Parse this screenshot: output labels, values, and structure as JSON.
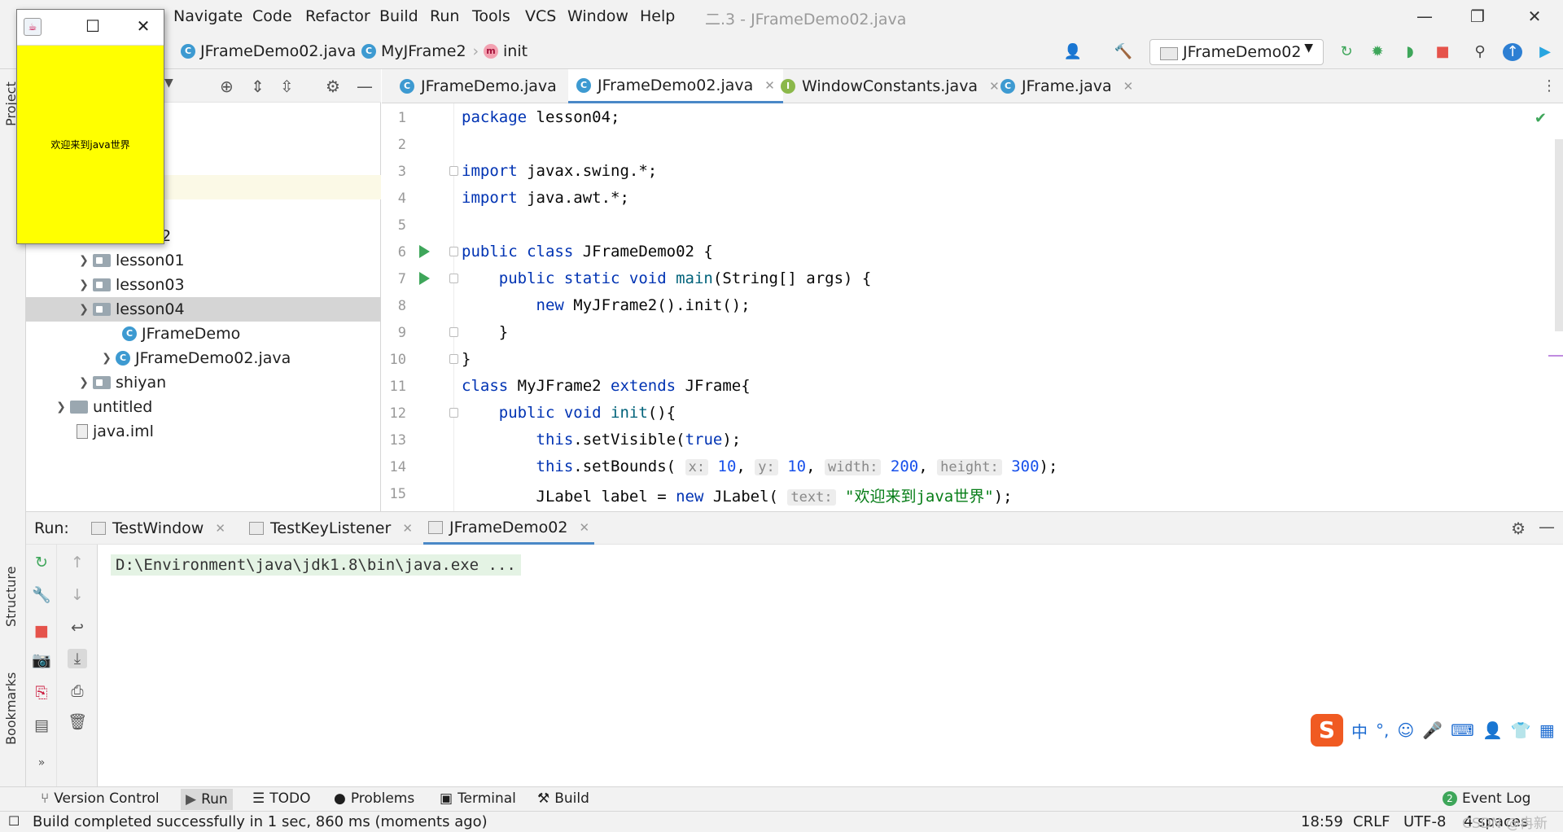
{
  "menubar": {
    "items": [
      "Navigate",
      "Code",
      "Refactor",
      "Build",
      "Run",
      "Tools",
      "VCS",
      "Window",
      "Help"
    ],
    "window_title": "二.3 - JFrameDemo02.java"
  },
  "navbar": {
    "breadcrumbs": [
      "JFrameDemo02.java",
      "MyJFrame2",
      "init"
    ],
    "run_config": "JFrameDemo02"
  },
  "sidebar": {
    "project_tab": "Project",
    "structure_tab": "Structure",
    "bookmarks_tab": "Bookmarks"
  },
  "project_tree": [
    {
      "label": "02",
      "indent": 3,
      "arrow": ""
    },
    {
      "label": "lesson01",
      "indent": 3,
      "arrow": ">"
    },
    {
      "label": "lesson03",
      "indent": 3,
      "arrow": ">"
    },
    {
      "label": "lesson04",
      "indent": 3,
      "arrow": "v"
    },
    {
      "label": "JFrameDemo",
      "indent": 4,
      "arrow": ""
    },
    {
      "label": "JFrameDemo02.java",
      "indent": 4,
      "arrow": ">"
    },
    {
      "label": "shiyan",
      "indent": 3,
      "arrow": ">"
    },
    {
      "label": "untitled",
      "indent": 2,
      "arrow": ">"
    },
    {
      "label": "java.iml",
      "indent": 2,
      "arrow": ""
    }
  ],
  "editor_tabs": [
    {
      "label": "JFrameDemo.java",
      "icon": "C"
    },
    {
      "label": "JFrameDemo02.java",
      "icon": "C"
    },
    {
      "label": "WindowConstants.java",
      "icon": "I"
    },
    {
      "label": "JFrame.java",
      "icon": "C"
    }
  ],
  "code": {
    "line_numbers": [
      "1",
      "2",
      "3",
      "4",
      "5",
      "6",
      "7",
      "8",
      "9",
      "10",
      "11",
      "12",
      "13",
      "14",
      "15"
    ],
    "l1a": "package",
    "l1b": " lesson04;",
    "l3a": "import",
    "l3b": " javax.swing.*;",
    "l4a": "import",
    "l4b": " java.awt.*;",
    "l6a": "public class",
    "l6b": " JFrameDemo02 {",
    "l7a": "    public static void",
    "l7b": " main",
    "l7c": "(String[] args) {",
    "l8a": "        new",
    "l8b": " MyJFrame2().init();",
    "l9": "    }",
    "l10": "}",
    "l11a": "class",
    "l11b": " MyJFrame2 ",
    "l11c": "extends",
    "l11d": " JFrame{",
    "l12a": "    public void",
    "l12b": " init",
    "l12c": "(){",
    "l13a": "        this",
    "l13b": ".setVisible(",
    "l13c": "true",
    "l13d": ");",
    "l14a": "        this",
    "l14b": ".setBounds(",
    "l14h1": "x:",
    "l14v1": "10",
    "l14h2": "y:",
    "l14v2": "10",
    "l14h3": "width:",
    "l14v3": "200",
    "l14h4": "height:",
    "l14v4": "300",
    "l14e": ");",
    "l15a": "        JLabel label = ",
    "l15b": "new",
    "l15c": " JLabel(",
    "l15h": "text:",
    "l15s": "\"欢迎来到java世界\"",
    "l15e": ");"
  },
  "run_panel": {
    "label": "Run:",
    "tabs": [
      "TestWindow",
      "TestKeyListener",
      "JFrameDemo02"
    ],
    "console_line": "D:\\Environment\\java\\jdk1.8\\bin\\java.exe ..."
  },
  "ime": {
    "logo": "S",
    "lang": "中"
  },
  "bottom_tools": [
    "Version Control",
    "Run",
    "TODO",
    "Problems",
    "Terminal",
    "Build"
  ],
  "event_log": "Event Log",
  "status": {
    "message": "Build completed successfully in 1 sec, 860 ms (moments ago)",
    "position": "18:59",
    "line_sep": "CRLF",
    "encoding": "UTF-8",
    "indent": "4 spaces",
    "watermark": "CSDN @冉新"
  },
  "jframe": {
    "label": "欢迎来到java世界"
  }
}
